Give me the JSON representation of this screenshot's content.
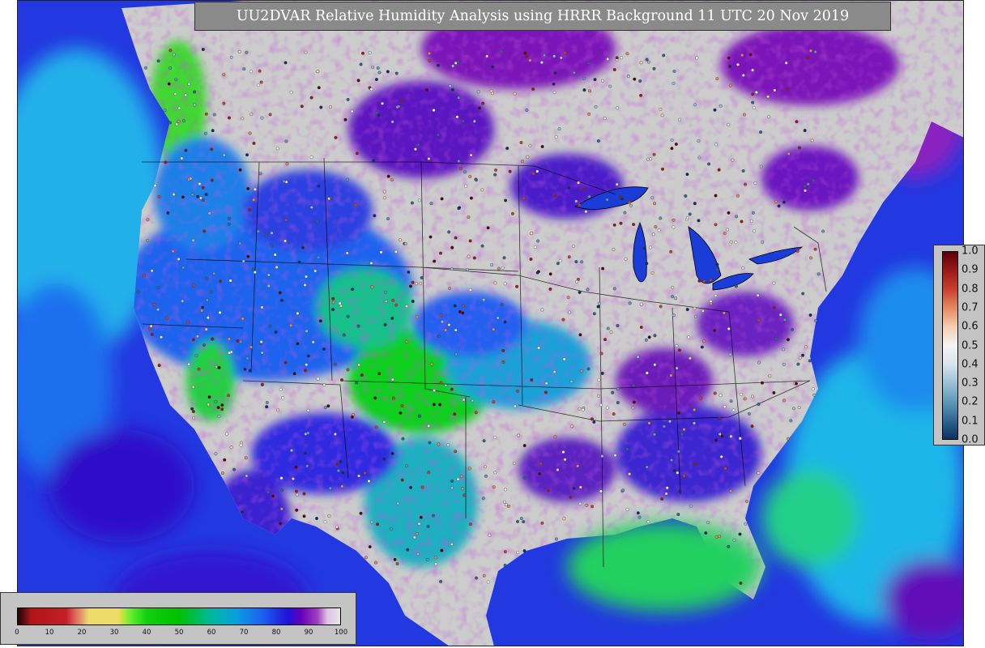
{
  "title": "UU2DVAR Relative Humidity Analysis using HRRR Background 11 UTC 20 Nov 2019",
  "humidity_colorbar": {
    "ticks": [
      "0",
      "10",
      "20",
      "30",
      "40",
      "50",
      "60",
      "70",
      "80",
      "90",
      "100"
    ],
    "range": [
      0,
      100
    ],
    "stops": [
      {
        "v": 0,
        "c": "#2b0000"
      },
      {
        "v": 2,
        "c": "#5a0f14"
      },
      {
        "v": 4,
        "c": "#b01418"
      },
      {
        "v": 15,
        "c": "#c42024"
      },
      {
        "v": 17,
        "c": "#d85050"
      },
      {
        "v": 20,
        "c": "#e6a070"
      },
      {
        "v": 22,
        "c": "#ecdc6a"
      },
      {
        "v": 31,
        "c": "#f0dc68"
      },
      {
        "v": 32,
        "c": "#d8e040"
      },
      {
        "v": 35,
        "c": "#60ef30"
      },
      {
        "v": 40,
        "c": "#10d010"
      },
      {
        "v": 50,
        "c": "#00c000"
      },
      {
        "v": 60,
        "c": "#00b8a0"
      },
      {
        "v": 68,
        "c": "#0a9ee0"
      },
      {
        "v": 76,
        "c": "#1a5ff0"
      },
      {
        "v": 84,
        "c": "#2010d8"
      },
      {
        "v": 88,
        "c": "#6a00b8"
      },
      {
        "v": 93,
        "c": "#a040c0"
      },
      {
        "v": 96,
        "c": "#e0c4e4"
      },
      {
        "v": 100,
        "c": "#e6e6e6"
      }
    ]
  },
  "station_colorbar": {
    "ticks": [
      "1.0",
      "0.9",
      "0.8",
      "0.7",
      "0.6",
      "0.5",
      "0.4",
      "0.3",
      "0.2",
      "0.1",
      "0.0"
    ],
    "range": [
      0,
      1
    ],
    "stops": [
      {
        "v": 1.0,
        "c": "#5a0008"
      },
      {
        "v": 0.9,
        "c": "#9a1a1a"
      },
      {
        "v": 0.8,
        "c": "#c84030"
      },
      {
        "v": 0.7,
        "c": "#e48a60"
      },
      {
        "v": 0.6,
        "c": "#f6cdb0"
      },
      {
        "v": 0.5,
        "c": "#f4f4f4"
      },
      {
        "v": 0.4,
        "c": "#d8e4ec"
      },
      {
        "v": 0.3,
        "c": "#9cc0d4"
      },
      {
        "v": 0.2,
        "c": "#5f9ab8"
      },
      {
        "v": 0.1,
        "c": "#2e6690"
      },
      {
        "v": 0.0,
        "c": "#0b2f60"
      }
    ]
  },
  "map_colors": {
    "ocean_deep": "#1a46e8",
    "ocean_light": "#2ab8e8",
    "gulf_green": "#2ad870",
    "land_dry": "#cfcfcf",
    "land_purple": "#8a18b8",
    "land_blue": "#2060f0",
    "land_green": "#20c830",
    "boundary": "#000000"
  }
}
